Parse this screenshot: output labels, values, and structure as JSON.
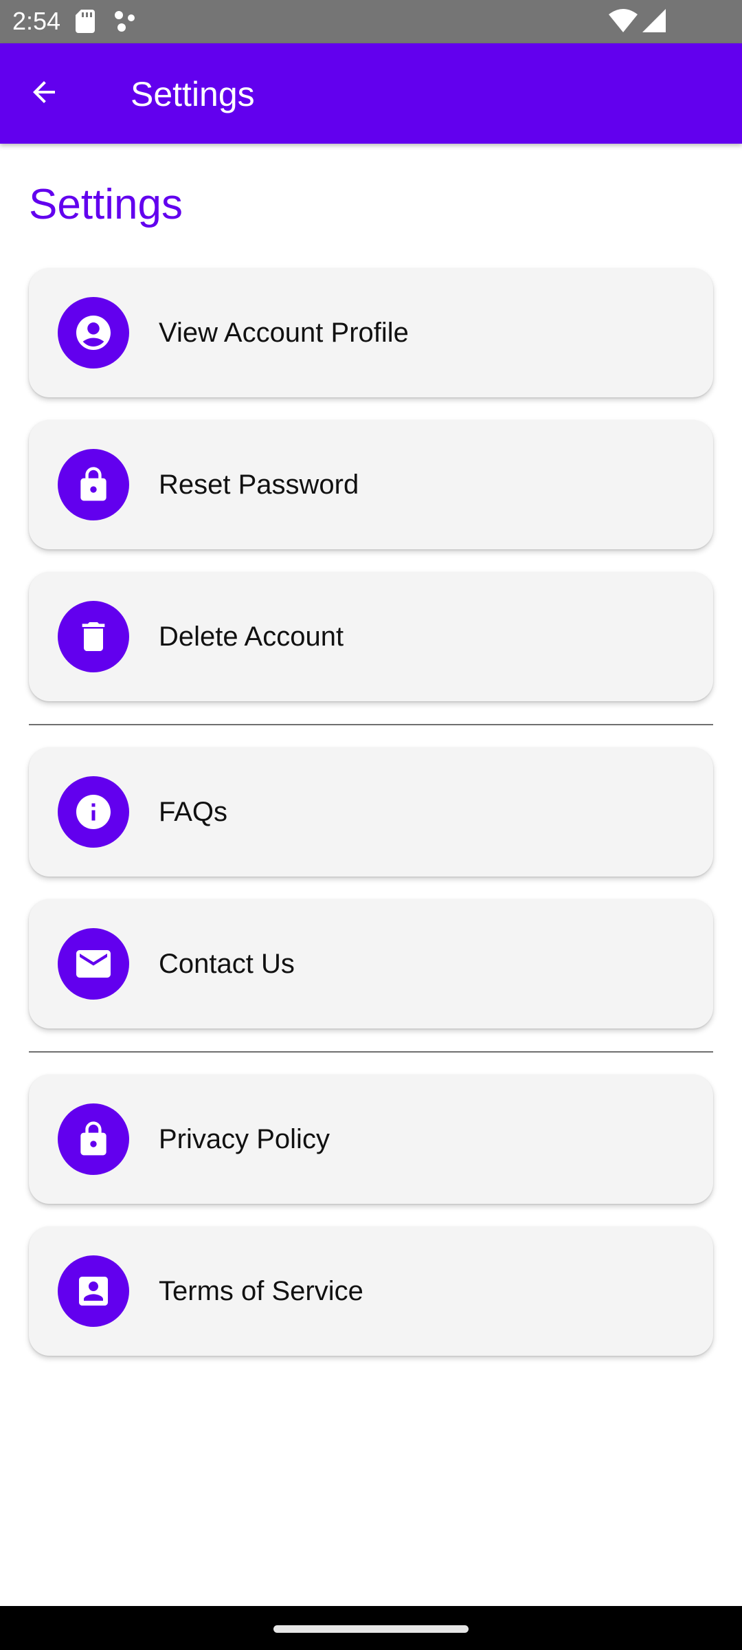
{
  "status_bar": {
    "time": "2:54",
    "icons": [
      "sd-card-icon",
      "notification-dots-icon",
      "wifi-icon",
      "cell-signal-icon"
    ]
  },
  "app_bar": {
    "title": "Settings",
    "back_icon": "arrow-left-icon"
  },
  "page": {
    "heading": "Settings"
  },
  "colors": {
    "accent": "#6200ee",
    "status_bar": "#757575",
    "card_background": "#f4f4f4",
    "nav_bar": "#000000"
  },
  "groups": [
    {
      "items": [
        {
          "label": "View Account Profile",
          "icon": "account-circle-icon"
        },
        {
          "label": "Reset Password",
          "icon": "lock-icon"
        },
        {
          "label": "Delete Account",
          "icon": "trash-icon"
        }
      ]
    },
    {
      "items": [
        {
          "label": "FAQs",
          "icon": "info-icon"
        },
        {
          "label": "Contact Us",
          "icon": "mail-icon"
        }
      ]
    },
    {
      "items": [
        {
          "label": "Privacy Policy",
          "icon": "lock-icon"
        },
        {
          "label": "Terms of Service",
          "icon": "contact-card-icon"
        }
      ]
    }
  ]
}
